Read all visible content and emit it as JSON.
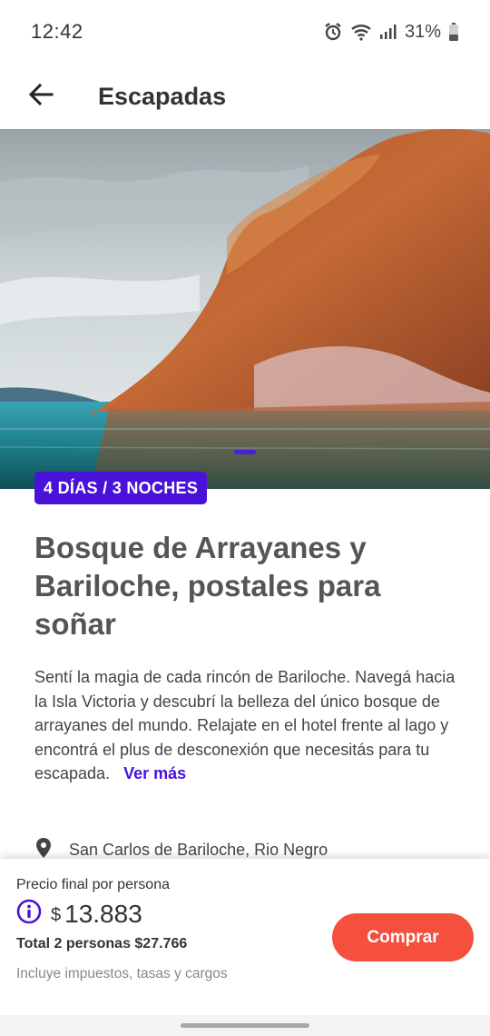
{
  "status_bar": {
    "time": "12:42",
    "battery": "31%",
    "icons": [
      "alarm-icon",
      "wifi-icon",
      "signal-icon",
      "battery-icon"
    ]
  },
  "app_bar": {
    "title": "Escapadas",
    "back_icon": "arrow-left-icon"
  },
  "hero": {
    "badge": "4 DÍAS / 3 NOCHES",
    "carousel_active_index": 0
  },
  "content": {
    "title": "Bosque de Arrayanes y Bariloche, postales para soñar",
    "description": "Sentí la magia de cada rincón de Bariloche. Navegá hacia la Isla Victoria y descubrí la belleza del único bosque de arrayanes del mundo. Relajate en el hotel frente al lago y encontrá el plus de desconexión que necesitás para tu escapada.",
    "ver_mas": "Ver más",
    "location": "San Carlos de Bariloche, Rio Negro"
  },
  "price_panel": {
    "label": "Precio final por persona",
    "currency": "$",
    "price": "13.883",
    "total": "Total 2 personas $27.766",
    "includes": "Incluye impuestos, tasas y cargos",
    "buy_label": "Comprar"
  },
  "colors": {
    "accent": "#4a12d9",
    "buy_button": "#f4503d",
    "title_text": "#555555"
  }
}
